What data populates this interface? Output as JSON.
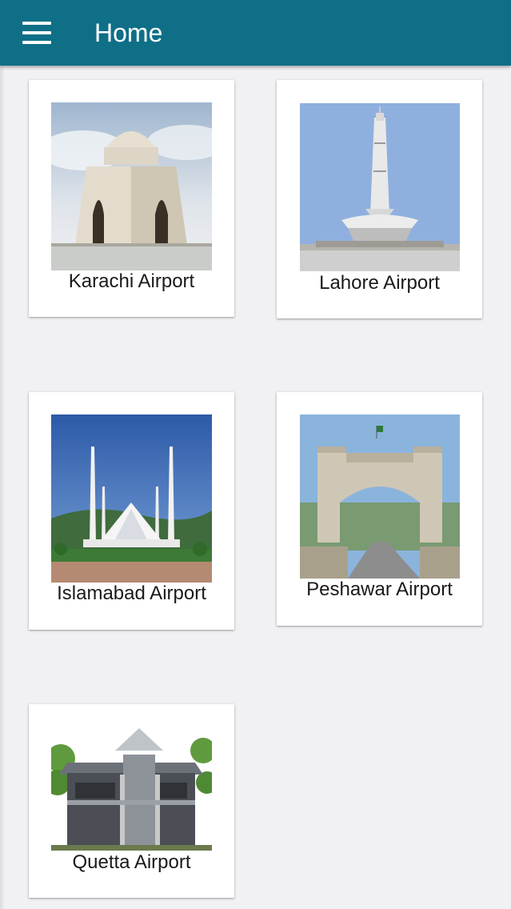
{
  "header": {
    "title": "Home",
    "menu_icon": "hamburger-menu-icon",
    "background_color": "#0f6f87"
  },
  "airports": [
    {
      "label": "Karachi Airport",
      "image": "mazar-e-quaid-image"
    },
    {
      "label": "Lahore Airport",
      "image": "minar-e-pakistan-image"
    },
    {
      "label": "Islamabad Airport",
      "image": "faisal-mosque-image"
    },
    {
      "label": "Peshawar Airport",
      "image": "bab-e-khyber-image"
    },
    {
      "label": "Quetta Airport",
      "image": "quetta-building-image"
    }
  ]
}
